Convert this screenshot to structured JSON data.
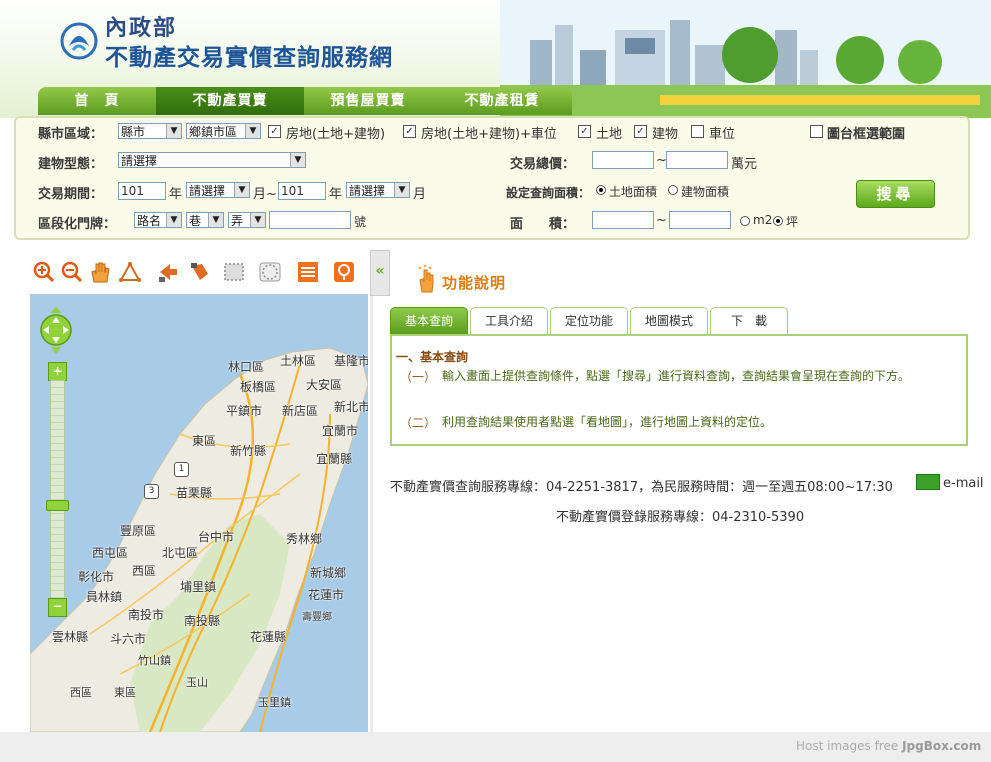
{
  "header": {
    "ministry": "內政部",
    "site_title": "不動產交易實價查詢服務網"
  },
  "nav": {
    "home": "首　頁",
    "sale": "不動產買賣",
    "presale": "預售屋買賣",
    "rent": "不動產租賃"
  },
  "search": {
    "city_label": "縣市區域：",
    "city_value": "縣市",
    "district_value": "鄉鎮市區",
    "opt_land_building": "房地(土地+建物)",
    "opt_land_building_parking": "房地(土地+建物)+車位",
    "opt_land": "土地",
    "opt_building": "建物",
    "opt_parking": "車位",
    "opt_map_frame": "圖台框選範圍",
    "building_type_label": "建物型態：",
    "building_type_value": "請選擇",
    "total_price_label": "交易總價：",
    "price_unit": "萬元",
    "tilde": "~",
    "period_label": "交易期間：",
    "year_from": "101",
    "year_unit": "年",
    "month_select": "請選擇",
    "month_unit_tilde": "月~",
    "year_to": "101",
    "month_unit": "月",
    "area_setting_label": "設定查詢面積：",
    "land_area": "土地面積",
    "building_area": "建物面積",
    "search_button": "搜尋",
    "door_label": "區段化門牌：",
    "road_select": "路名",
    "lane_select": "巷",
    "alley_select": "弄",
    "number_unit": "號",
    "area_label": "面　　積：",
    "unit_m2": "m2",
    "unit_ping": "坪"
  },
  "map": {
    "labels": [
      "林口區",
      "土林區",
      "基隆市",
      "板橋區",
      "大安區",
      "平鎮市",
      "新店區",
      "新北市",
      "宜蘭市",
      "東區",
      "新竹縣",
      "宜蘭縣",
      "苗栗縣",
      "豐原區",
      "台中市",
      "秀林鄉",
      "西屯區",
      "北屯區",
      "彰化市",
      "西區",
      "新城鄉",
      "員林鎮",
      "埔里鎮",
      "花蓮市",
      "南投市",
      "南投縣",
      "壽豐鄉",
      "雲林縣",
      "斗六市",
      "花蓮縣",
      "竹山鎮",
      "玉山",
      "西區",
      "東區",
      "玉里鎮"
    ],
    "route_1": "1",
    "route_3": "3"
  },
  "panel": {
    "title": "功能說明",
    "tabs": [
      "基本查詢",
      "工具介紹",
      "定位功能",
      "地圖模式",
      "下　載"
    ],
    "section_heading": "一、基本查詢",
    "items": [
      {
        "num": "（一）",
        "text": "輸入畫面上提供查詢條件，點選「搜尋」進行資料查詢，查詢結果會呈現在查詢的下方。"
      },
      {
        "num": "（二）",
        "text": "利用查詢結果使用者點選「看地圖」，進行地圖上資料的定位。"
      }
    ],
    "hotline": "不動產實價查詢服務專線：04-2251-3817，為民服務時間：週一至週五08:00~17:30",
    "email": "e-mail",
    "registration_hotline": "不動產實價登錄服務專線：04-2310-5390"
  },
  "footer": {
    "host_prefix": "Host images free ",
    "host_brand": "JpgBox.com"
  }
}
